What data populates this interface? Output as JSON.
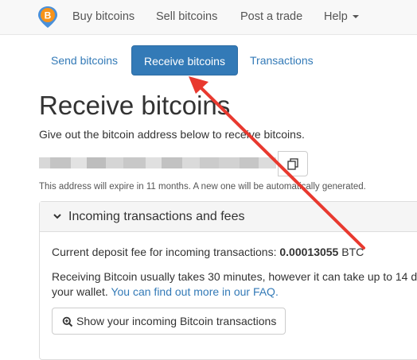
{
  "navbar": {
    "items": [
      {
        "label": "Buy bitcoins"
      },
      {
        "label": "Sell bitcoins"
      },
      {
        "label": "Post a trade"
      },
      {
        "label": "Help"
      }
    ]
  },
  "tabs": [
    {
      "label": "Send bitcoins",
      "active": false
    },
    {
      "label": "Receive bitcoins",
      "active": true
    },
    {
      "label": "Transactions",
      "active": false
    }
  ],
  "page_title": "Receive bitcoins",
  "intro": "Give out the bitcoin address below to receive bitcoins.",
  "expire_note": "This address will expire in 11 months. A new one will be automatically generated.",
  "panel": {
    "title": "Incoming transactions and fees",
    "fee_prefix": "Current deposit fee for incoming transactions:",
    "fee_value": "0.00013055",
    "fee_unit": "BTC",
    "wait_text_1": "Receiving Bitcoin usually takes 30 minutes, however it can take up to 14 d",
    "wait_text_2": "your wallet.",
    "faq_link": "You can find out more in our FAQ.",
    "show_button": "Show your incoming Bitcoin transactions"
  },
  "colors": {
    "accent": "#337ab7",
    "annotation_arrow": "#e8392f"
  }
}
